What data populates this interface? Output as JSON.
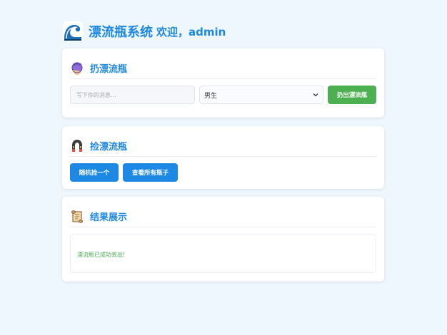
{
  "header": {
    "title": "漂流瓶系统",
    "welcome": "欢迎，admin",
    "logo_icon": "wave-icon"
  },
  "throw_section": {
    "title": "扔漂流瓶",
    "icon": "hand-icon",
    "message_placeholder": "写下你的消息...",
    "message_value": "",
    "gender_selected": "男生",
    "throw_button": "扔出漂流瓶"
  },
  "pick_section": {
    "title": "捡漂流瓶",
    "icon": "magnet-icon",
    "random_button": "随机捡一个",
    "view_all_button": "查看所有瓶子"
  },
  "result_section": {
    "title": "结果展示",
    "icon": "scroll-icon",
    "message": "漂流瓶已成功丢出!"
  },
  "colors": {
    "accent": "#1e88e5",
    "success": "#4caf50",
    "background": "#eef6fe"
  }
}
